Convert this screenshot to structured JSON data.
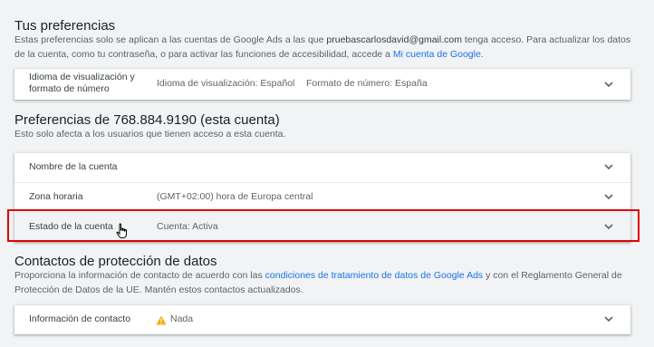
{
  "prefs": {
    "title": "Tus preferencias",
    "desc_before_email": "Estas preferencias solo se aplican a las cuentas de Google Ads a las que ",
    "email": "pruebascarlosdavid@gmail.com",
    "desc_after_email": " tenga acceso. Para actualizar los datos de la cuenta, como tu contraseña, o para activar las funciones de accesibilidad, accede a ",
    "link": "Mi cuenta de Google",
    "end": ".",
    "language_row": {
      "label_line1": "Idioma de visualización y",
      "label_line2": "formato de número",
      "display_language": "Idioma de visualización: Español",
      "number_format": "Formato de número: España"
    }
  },
  "account": {
    "title": "Preferencias de 768.884.9190 (esta cuenta)",
    "desc": "Esto solo afecta a los usuarios que tienen acceso a esta cuenta.",
    "rows": [
      {
        "label": "Nombre de la cuenta",
        "value": ""
      },
      {
        "label": "Zona horaria",
        "value": "(GMT+02:00) hora de Europa central"
      },
      {
        "label": "Estado de la cuenta",
        "value": "Cuenta: Activa"
      }
    ]
  },
  "contacts": {
    "title": "Contactos de protección de datos",
    "desc_before_link": "Proporciona la información de contacto de acuerdo con las ",
    "link": "condiciones de tratamiento de datos de Google Ads",
    "desc_after_link": " y con el Reglamento General de Protección de Datos de la UE. Mantén estos contactos actualizados.",
    "row": {
      "label": "Información de contacto",
      "value": "Nada"
    }
  },
  "colors": {
    "accent": "#1a73e8",
    "highlight": "#e00000",
    "warning": "#f9ab00"
  },
  "icons": [
    "chevron-down-icon",
    "warning-icon",
    "hand-cursor-icon"
  ]
}
